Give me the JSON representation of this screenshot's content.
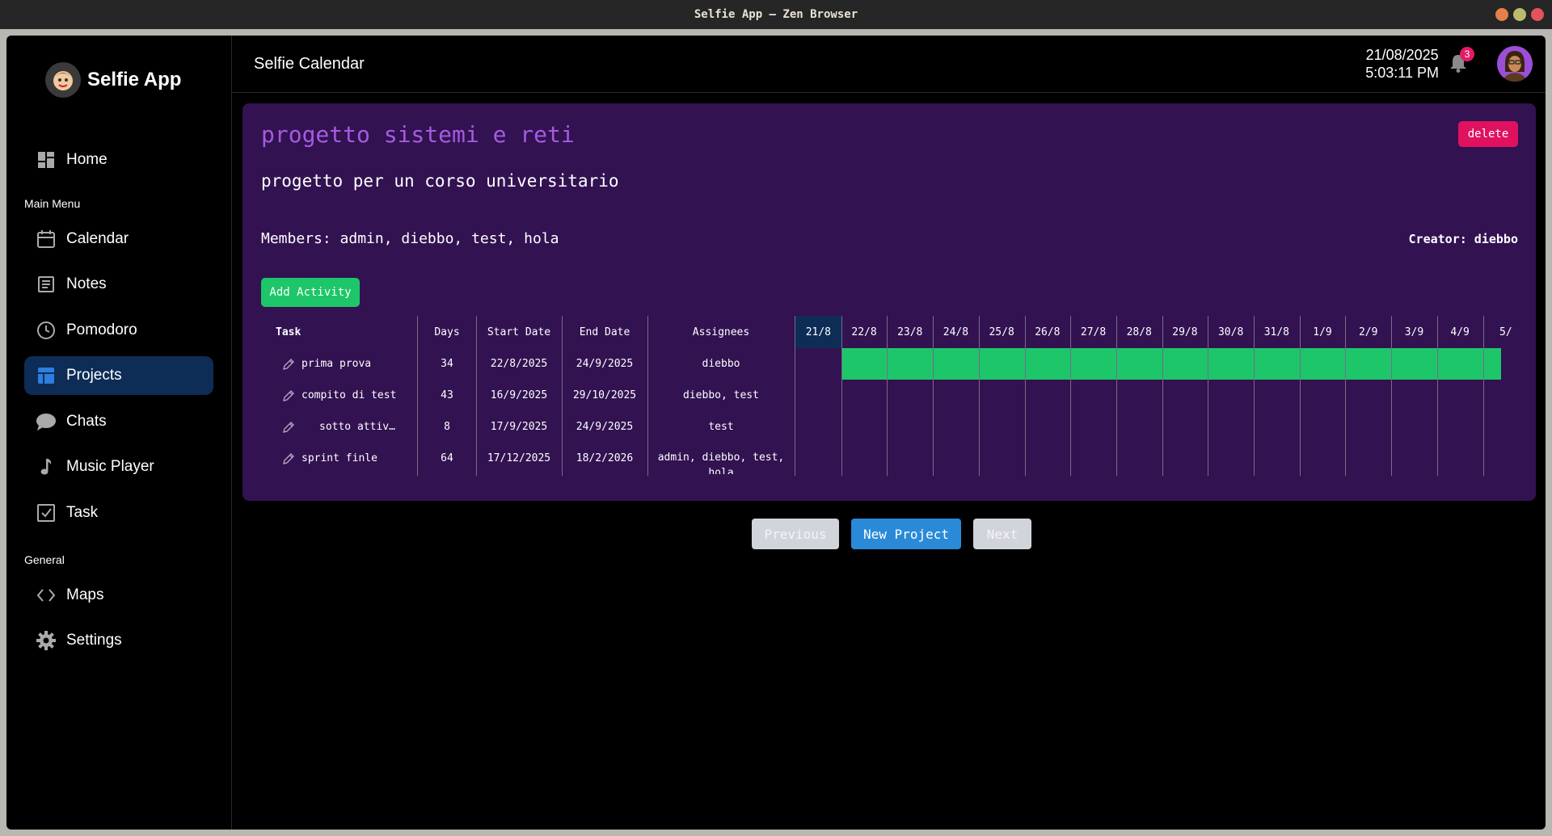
{
  "window": {
    "title": "Selfie App — Zen Browser"
  },
  "brand": {
    "name": "Selfie App"
  },
  "nav": {
    "home": "Home",
    "main_menu_label": "Main Menu",
    "calendar": "Calendar",
    "notes": "Notes",
    "pomodoro": "Pomodoro",
    "projects": "Projects",
    "chats": "Chats",
    "music": "Music Player",
    "task": "Task",
    "general_label": "General",
    "maps": "Maps",
    "settings": "Settings"
  },
  "header": {
    "title": "Selfie Calendar",
    "date": "21/08/2025",
    "time": "5:03:11 PM",
    "notifications": "3"
  },
  "project": {
    "title": "progetto sistemi e reti",
    "description": "progetto per un corso universitario",
    "members": "Members: admin, diebbo, test, hola",
    "creator": "Creator: diebbo",
    "delete_label": "delete",
    "add_activity_label": "Add Activity"
  },
  "table": {
    "headers": {
      "task": "Task",
      "days": "Days",
      "start": "Start Date",
      "end": "End Date",
      "assignees": "Assignees"
    },
    "dates": [
      "21/8",
      "22/8",
      "23/8",
      "24/8",
      "25/8",
      "26/8",
      "27/8",
      "28/8",
      "29/8",
      "30/8",
      "31/8",
      "1/9",
      "2/9",
      "3/9",
      "4/9",
      "5/"
    ],
    "today_index": 0,
    "rows": [
      {
        "task": "prima prova",
        "days": "34",
        "start": "22/8/2025",
        "end": "24/9/2025",
        "assignees": "diebbo",
        "bar_start_index": 1
      },
      {
        "task": "compito di test",
        "days": "43",
        "start": "16/9/2025",
        "end": "29/10/2025",
        "assignees": "diebbo, test"
      },
      {
        "task": "sotto attiv…",
        "days": "8",
        "start": "17/9/2025",
        "end": "24/9/2025",
        "assignees": "test"
      },
      {
        "task": "sprint finle",
        "days": "64",
        "start": "17/12/2025",
        "end": "18/2/2026",
        "assignees": "admin, diebbo, test, hola"
      }
    ]
  },
  "pager": {
    "previous": "Previous",
    "new_project": "New Project",
    "next": "Next"
  },
  "colors": {
    "accent": "#a55be0",
    "card": "#321251",
    "active_nav": "#0d2d57",
    "bar": "#1ec66a",
    "delete": "#e0115f",
    "new_project": "#2a8ad8"
  }
}
